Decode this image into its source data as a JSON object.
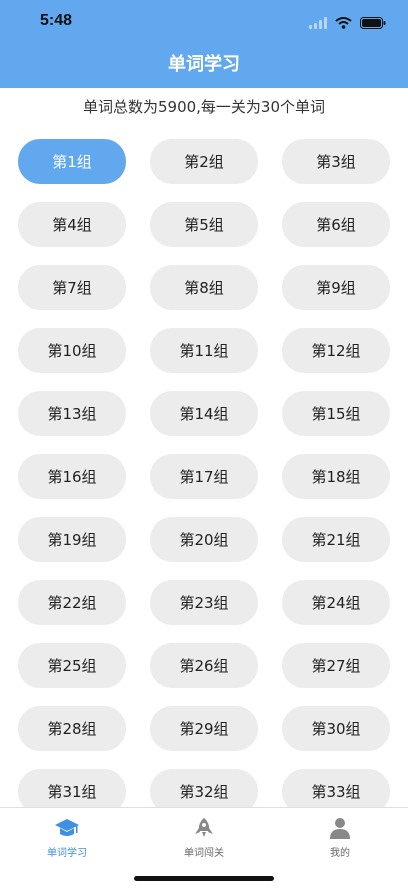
{
  "status_bar": {
    "time": "5:48"
  },
  "header": {
    "title": "单词学习"
  },
  "summary": "单词总数为5900,每一关为30个单词",
  "groups": [
    "第1组",
    "第2组",
    "第3组",
    "第4组",
    "第5组",
    "第6组",
    "第7组",
    "第8组",
    "第9组",
    "第10组",
    "第11组",
    "第12组",
    "第13组",
    "第14组",
    "第15组",
    "第16组",
    "第17组",
    "第18组",
    "第19组",
    "第20组",
    "第21组",
    "第22组",
    "第23组",
    "第24组",
    "第25组",
    "第26组",
    "第27组",
    "第28组",
    "第29组",
    "第30组",
    "第31组",
    "第32组",
    "第33组"
  ],
  "selected_group": "第1组",
  "tabbar": {
    "items": [
      {
        "label": "单词学习",
        "icon": "graduation-cap-icon",
        "active": true
      },
      {
        "label": "单词闯关",
        "icon": "rocket-icon",
        "active": false
      },
      {
        "label": "我的",
        "icon": "person-icon",
        "active": false
      }
    ]
  },
  "colors": {
    "accent": "#62a8ef",
    "tab_active": "#3f8fe2",
    "button_bg": "#ececec"
  }
}
